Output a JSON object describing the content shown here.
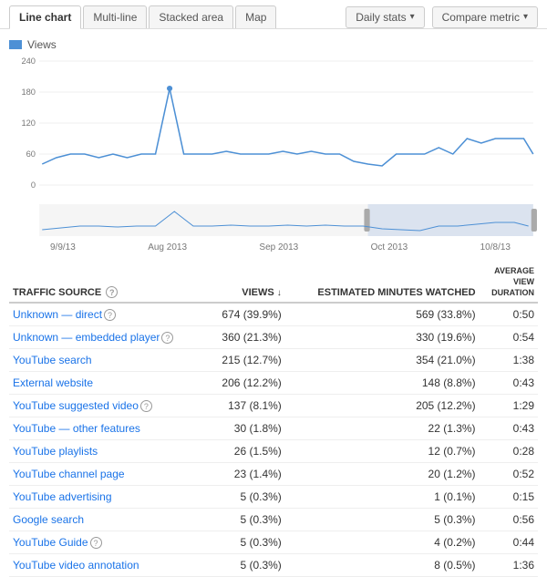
{
  "tabs": {
    "items": [
      "Line chart",
      "Multi-line",
      "Stacked area",
      "Map"
    ],
    "active": 0
  },
  "controls": {
    "daily_stats": "Daily stats",
    "compare_metric": "Compare metric"
  },
  "chart": {
    "legend": "Views",
    "y_labels": [
      "240",
      "180",
      "120",
      "60",
      "0"
    ],
    "x_dates": [
      "9/9/13",
      "Aug 2013",
      "Sep 2013",
      "Oct 2013",
      "10/8/13"
    ]
  },
  "table": {
    "headers": {
      "source": "TRAFFIC SOURCE",
      "views": "VIEWS",
      "minutes": "ESTIMATED MINUTES WATCHED",
      "duration": "AVERAGE VIEW DURATION"
    },
    "rows": [
      {
        "source": "Unknown — direct",
        "views": "674 (39.9%)",
        "minutes": "569 (33.8%)",
        "duration": "0:50",
        "has_help": true
      },
      {
        "source": "Unknown — embedded player",
        "views": "360 (21.3%)",
        "minutes": "330 (19.6%)",
        "duration": "0:54",
        "has_help": true
      },
      {
        "source": "YouTube search",
        "views": "215 (12.7%)",
        "minutes": "354 (21.0%)",
        "duration": "1:38",
        "has_help": false
      },
      {
        "source": "External website",
        "views": "206 (12.2%)",
        "minutes": "148 (8.8%)",
        "duration": "0:43",
        "has_help": false
      },
      {
        "source": "YouTube suggested video",
        "views": "137 (8.1%)",
        "minutes": "205 (12.2%)",
        "duration": "1:29",
        "has_help": true
      },
      {
        "source": "YouTube — other features",
        "views": "30 (1.8%)",
        "minutes": "22 (1.3%)",
        "duration": "0:43",
        "has_help": false
      },
      {
        "source": "YouTube playlists",
        "views": "26 (1.5%)",
        "minutes": "12 (0.7%)",
        "duration": "0:28",
        "has_help": false
      },
      {
        "source": "YouTube channel page",
        "views": "23 (1.4%)",
        "minutes": "20 (1.2%)",
        "duration": "0:52",
        "has_help": false
      },
      {
        "source": "YouTube advertising",
        "views": "5 (0.3%)",
        "minutes": "1 (0.1%)",
        "duration": "0:15",
        "has_help": false
      },
      {
        "source": "Google search",
        "views": "5 (0.3%)",
        "minutes": "5 (0.3%)",
        "duration": "0:56",
        "has_help": false
      },
      {
        "source": "YouTube Guide",
        "views": "5 (0.3%)",
        "minutes": "4 (0.2%)",
        "duration": "0:44",
        "has_help": true
      },
      {
        "source": "YouTube video annotation",
        "views": "5 (0.3%)",
        "minutes": "8 (0.5%)",
        "duration": "1:36",
        "has_help": false
      }
    ]
  }
}
